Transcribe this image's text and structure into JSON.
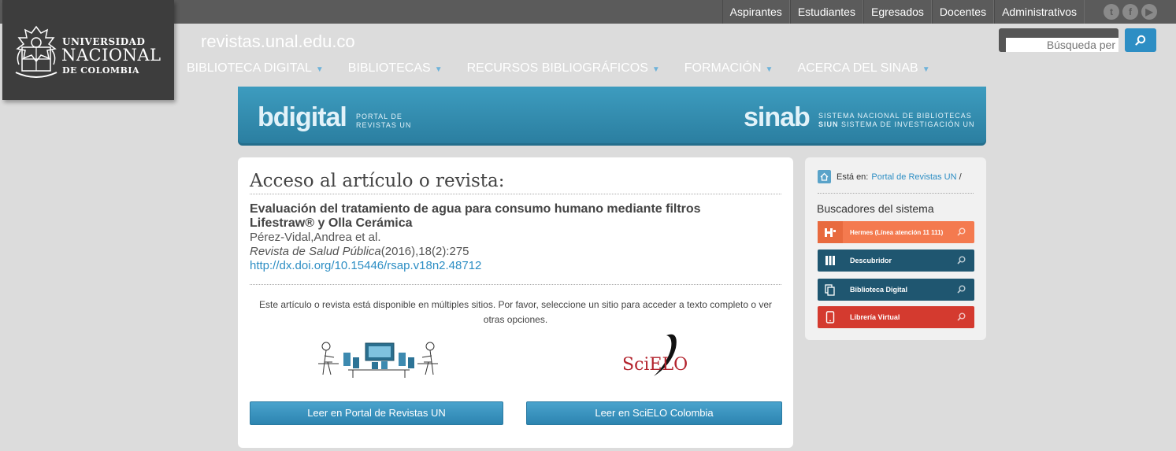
{
  "topbar": {
    "links": [
      "Aspirantes",
      "Estudiantes",
      "Egresados",
      "Docentes",
      "Administrativos"
    ],
    "social": [
      "twitter-icon",
      "facebook-icon",
      "youtube-icon"
    ]
  },
  "logo": {
    "line1": "UNIVERSIDAD",
    "line2": "NACIONAL",
    "line3": "DE COLOMBIA"
  },
  "site_title": "revistas.unal.edu.co",
  "nav": [
    "BIBLIOTECA DIGITAL",
    "BIBLIOTECAS",
    "RECURSOS BIBLIOGRÁFICOS",
    "FORMACIÓN",
    "ACERCA DEL SINAB"
  ],
  "search": {
    "placeholder": "Búsqueda per"
  },
  "banner": {
    "bdigital": "bdigital",
    "bdigital_sub1": "PORTAL DE",
    "bdigital_sub2": "REVISTAS UN",
    "sinab": "sinab",
    "sinab_sub1": "SISTEMA NACIONAL DE BIBLIOTECAS",
    "sinab_sub2a": "SIUN",
    "sinab_sub2b": " SISTEMA DE INVESTIGACIÓN UN"
  },
  "main": {
    "heading": "Acceso al artículo o revista:",
    "article_title": "Evaluación del tratamiento de agua para consumo humano mediante filtros Lifestraw® y Olla Cerámica",
    "authors": "Pérez-Vidal,Andrea et al.",
    "journal": "Revista de Salud Pública",
    "citation": "(2016),18(2):275",
    "doi": "http://dx.doi.org/10.15446/rsap.v18n2.48712",
    "notice": "Este artículo o revista está disponible en múltiples sitios. Por favor, seleccione un sitio para acceder a texto completo o ver otras opciones.",
    "scielo_logo": "SciELO",
    "btn_portal": "Leer en Portal de Revistas UN",
    "btn_scielo": "Leer en SciELO Colombia"
  },
  "sidebar": {
    "crumb_prefix": "Está en:",
    "crumb_link": "Portal de Revistas UN",
    "crumb_sep": "/",
    "heading": "Buscadores del sistema",
    "buttons": [
      {
        "label": "Hermes (Línea atención 11 111)",
        "color": "#f47a4f",
        "icon_color": "#f47a4f",
        "icon": "hermes-icon"
      },
      {
        "label": "Descubridor",
        "color": "#1f5670",
        "icon_color": "#1f5670",
        "icon": "books-icon"
      },
      {
        "label": "Biblioteca Digital",
        "color": "#1f5670",
        "icon_color": "#1f5670",
        "icon": "documents-icon"
      },
      {
        "label": "Librería Virtual",
        "color": "#d43a2f",
        "icon_color": "#d43a2f",
        "icon": "tablet-icon"
      }
    ]
  }
}
